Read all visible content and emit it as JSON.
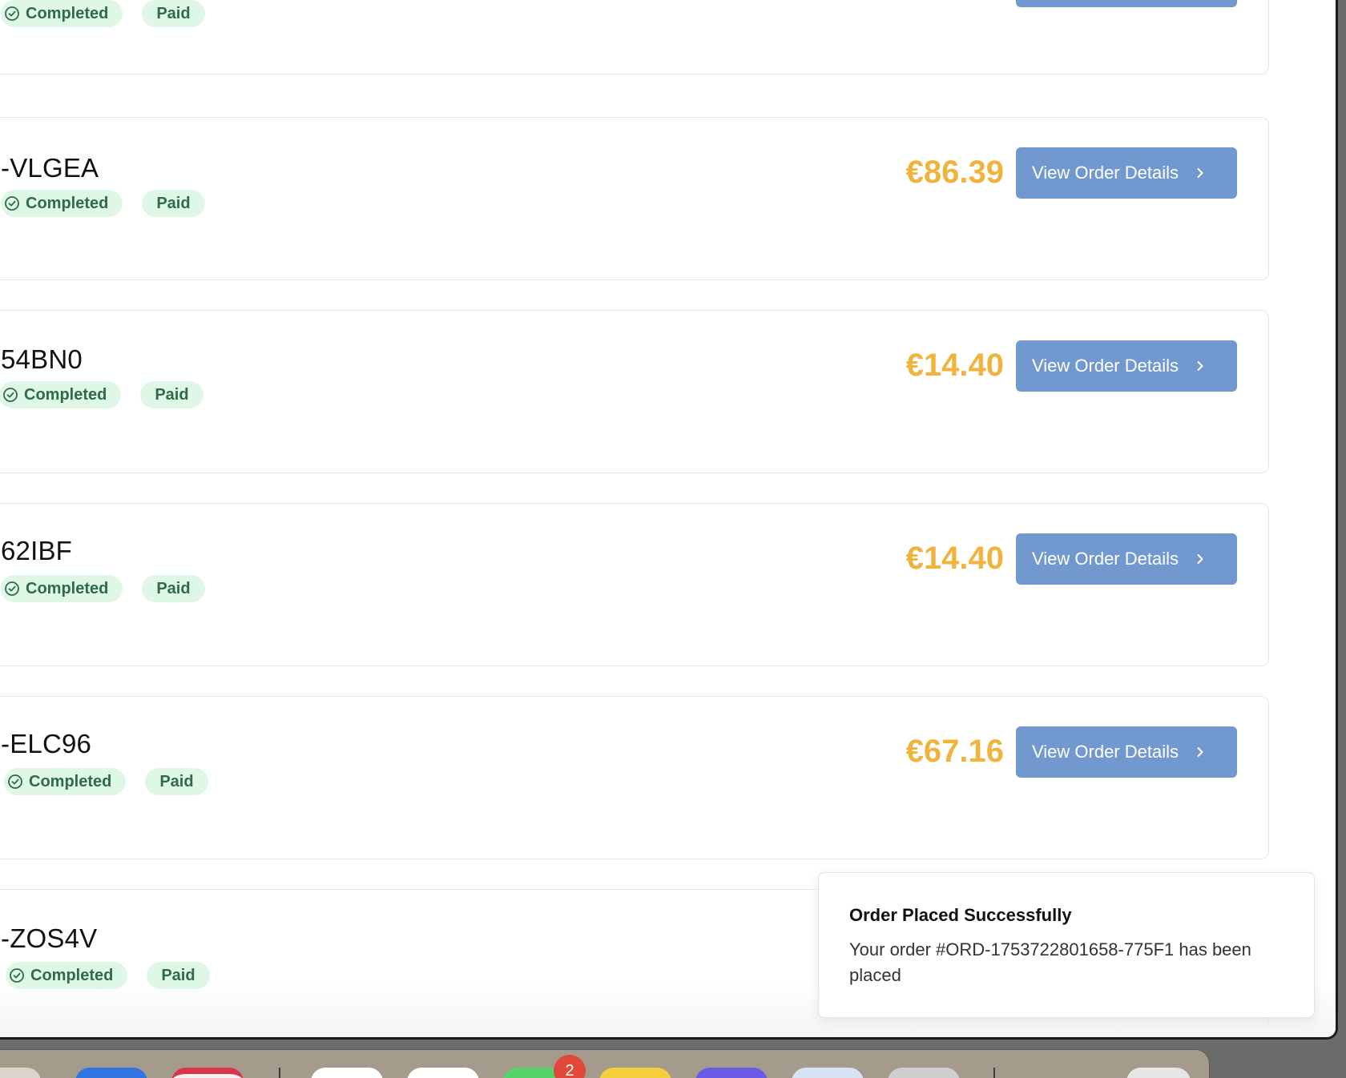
{
  "orders": [
    {
      "id": "",
      "status": "Completed",
      "payment": "Paid",
      "price": "",
      "button_label": ""
    },
    {
      "id": "-VLGEA",
      "status": "Completed",
      "payment": "Paid",
      "price": "€86.39",
      "button_label": "View Order Details"
    },
    {
      "id": "54BN0",
      "status": "Completed",
      "payment": "Paid",
      "price": "€14.40",
      "button_label": "View Order Details"
    },
    {
      "id": "62IBF",
      "status": "Completed",
      "payment": "Paid",
      "price": "€14.40",
      "button_label": "View Order Details"
    },
    {
      "id": "-ELC96",
      "status": "Completed",
      "payment": "Paid",
      "price": "€67.16",
      "button_label": "View Order Details"
    },
    {
      "id": "-ZOS4V",
      "status": "Completed",
      "payment": "Paid",
      "price": "",
      "button_label": ""
    }
  ],
  "toast": {
    "title": "Order Placed Successfully",
    "message": "Your order #ORD-1753722801658-775F1 has been placed"
  },
  "dock": {
    "messages_badge": "2"
  },
  "colors": {
    "price": "#f0b43e",
    "button": "#7299cf",
    "badge_bg": "#def7e6",
    "badge_text": "#2f6b47"
  }
}
